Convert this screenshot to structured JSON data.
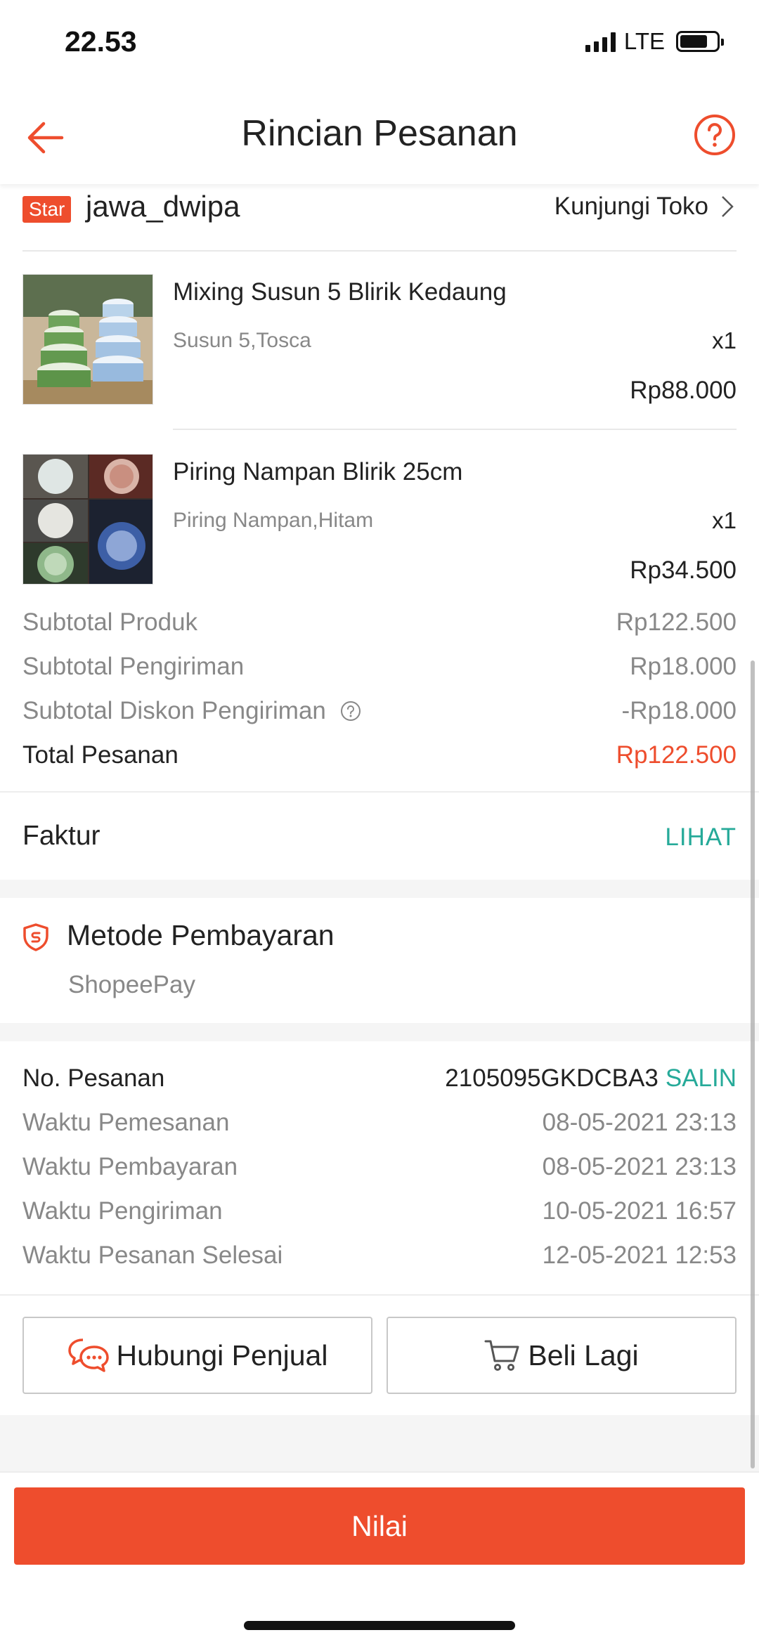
{
  "status_bar": {
    "time": "22.53",
    "network": "LTE"
  },
  "header": {
    "title": "Rincian Pesanan"
  },
  "shop": {
    "badge": "Star",
    "name": "jawa_dwipa",
    "visit_label": "Kunjungi Toko"
  },
  "products": [
    {
      "name": "Mixing Susun 5 Blirik Kedaung",
      "variant": "Susun 5,Tosca",
      "qty": "x1",
      "price": "Rp88.000"
    },
    {
      "name": "Piring Nampan Blirik  25cm",
      "variant": "Piring Nampan,Hitam",
      "qty": "x1",
      "price": "Rp34.500"
    }
  ],
  "totals": {
    "subtotal_product_label": "Subtotal Produk",
    "subtotal_product_value": "Rp122.500",
    "subtotal_shipping_label": "Subtotal Pengiriman",
    "subtotal_shipping_value": "Rp18.000",
    "shipping_discount_label": "Subtotal Diskon Pengiriman",
    "shipping_discount_value": "-Rp18.000",
    "order_total_label": "Total Pesanan",
    "order_total_value": "Rp122.500"
  },
  "invoice": {
    "label": "Faktur",
    "action": "LIHAT"
  },
  "payment": {
    "title": "Metode Pembayaran",
    "method": "ShopeePay"
  },
  "order_info": {
    "order_no_label": "No. Pesanan",
    "order_no_value": "2105095GKDCBA3",
    "copy_label": "SALIN",
    "rows": [
      {
        "label": "Waktu Pemesanan",
        "value": "08-05-2021 23:13"
      },
      {
        "label": "Waktu Pembayaran",
        "value": "08-05-2021 23:13"
      },
      {
        "label": "Waktu Pengiriman",
        "value": "10-05-2021 16:57"
      },
      {
        "label": "Waktu Pesanan Selesai",
        "value": "12-05-2021 12:53"
      }
    ]
  },
  "actions": {
    "contact_seller": "Hubungi Penjual",
    "buy_again": "Beli Lagi"
  },
  "bottom": {
    "rate_label": "Nilai"
  },
  "colors": {
    "brand": "#ee4d2d",
    "link": "#26aa99",
    "muted": "#888888"
  },
  "icons": [
    "back-arrow-icon",
    "help-icon",
    "chevron-right-icon",
    "info-icon",
    "shield-icon",
    "chat-icon",
    "cart-icon"
  ]
}
